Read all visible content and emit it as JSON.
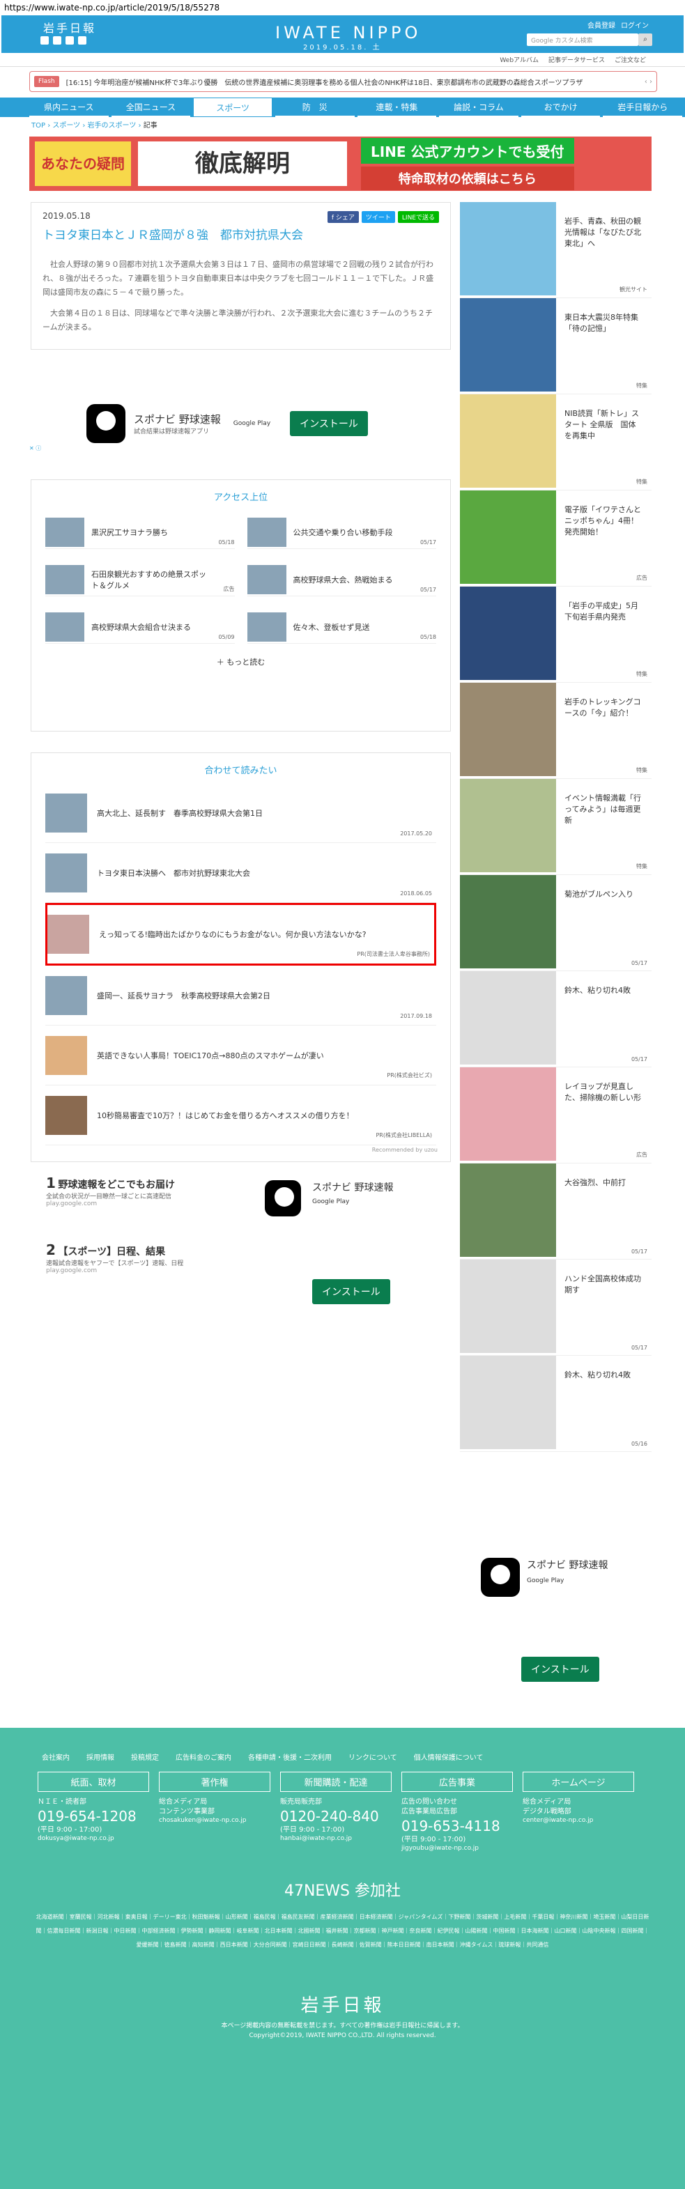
{
  "url": "https://www.iwate-np.co.jp/article/2019/5/18/55278",
  "header": {
    "logo_jp": "岩手日報",
    "logo_en": "IWATE NIPPO",
    "date": "2019.05.18. 土",
    "links": [
      "会員登録",
      "ログイン"
    ],
    "search_placeholder": "Google カスタム検索",
    "subnav": [
      "Webアルバム",
      "記事データサービス",
      "ご注文など"
    ]
  },
  "flash": {
    "label": "Flash",
    "time": "[16:15]",
    "text": "今年明治座が候補NHK杯で3年ぶり優勝　伝統の世界遺産候補に奥羽理事を務める個人社会のNHK杯は18日、東京都調布市の武蔵野の森総合スポーツプラザ",
    "nav": "‹ ›"
  },
  "gnav": [
    "県内ニュース",
    "全国ニュース",
    "スポーツ",
    "防　災",
    "連載・特集",
    "論説・コラム",
    "おでかけ",
    "岩手日報から"
  ],
  "breadcrumb": [
    "TOP",
    "スポーツ",
    "岩手のスポーツ",
    "記事"
  ],
  "banner": {
    "yellow": "あなたの疑問",
    "middle": "徹底解明",
    "line1": "LINE 公式アカウントでも受付",
    "line2": "特命取材の依頼はこちら"
  },
  "article": {
    "date": "2019.05.18",
    "title": "トヨタ東日本とＪＲ盛岡が８強　都市対抗県大会",
    "share": [
      "f シェア",
      "ツイート",
      "LINEで送る"
    ],
    "body": [
      "社会人野球の第９０回都市対抗１次予選県大会第３日は１７日、盛岡市の県営球場で２回戦の残り２試合が行われ、８強が出そろった。７連覇を狙うトヨタ自動車東日本は中央クラブを七回コールド１１－１で下した。ＪＲ盛岡は盛岡市友の森に５－４で競り勝った。",
      "大会第４日の１８日は、同球場などで準々決勝と準決勝が行われ、２次予選東北大会に進む３チームのうち２チームが決まる。"
    ]
  },
  "ad_app": {
    "title": "スポナビ 野球速報",
    "sub": "試合結果は野球速報アプリ",
    "store": "Google Play",
    "install": "インストール"
  },
  "access": {
    "title": "アクセス上位",
    "items": [
      {
        "title": "黒沢尻工サヨナラ勝ち",
        "date": "05/18"
      },
      {
        "title": "公共交通や乗り合い移動手段",
        "date": "05/17"
      },
      {
        "title": "石田泉観光おすすめの絶景スポット＆グルメ",
        "date": "広告"
      },
      {
        "title": "高校野球県大会、熱戦始まる",
        "date": "05/17"
      },
      {
        "title": "高校野球県大会組合せ決まる",
        "date": "05/09"
      },
      {
        "title": "佐々木、登板せず見送",
        "date": "05/18"
      }
    ],
    "more": "もっと読む"
  },
  "related": {
    "title": "合わせて読みたい",
    "items": [
      {
        "title": "高大北上、延長制す　春季高校野球県大会第1日",
        "date": "2017.05.20"
      },
      {
        "title": "トヨタ東日本決勝へ　都市対抗野球東北大会",
        "date": "2018.06.05"
      },
      {
        "title": "えっ知ってる!臨時出たばかりなのにもうお金がない。何か良い方法ないかな?",
        "date": "PR(司法書士法人卑谷事務所)"
      },
      {
        "title": "盛岡一、延長サヨナラ　秋季高校野球県大会第2日",
        "date": "2017.09.18"
      },
      {
        "title": "英語できない人事局！TOEIC170点→880点のスマホゲームが凄い",
        "date": "PR(株式会社ビズ)"
      },
      {
        "title": "10秒簡易審査で10万？！はじめてお金を借りる方へオススメの借り方を！",
        "date": "PR(株式会社LIBELLA)"
      }
    ],
    "recommended": "Recommended by  uzou"
  },
  "gads": [
    {
      "num": "1",
      "title": "野球速報をどこでもお届け",
      "sub": "全試合の状況が一目瞭然一球ごとに高速配信",
      "domain": "play.google.com"
    },
    {
      "num": "2",
      "title": "【スポーツ】日程、結果",
      "sub": "速報試合速報をヤフーで【スポーツ】速報、日程",
      "domain": "play.google.com"
    }
  ],
  "sidebar": [
    {
      "title": "岩手、青森、秋田の観光情報は「なびたび北東北」へ",
      "tag": "観光サイト"
    },
    {
      "title": "東日本大震災8年特集「待の記憶」",
      "tag": "特集"
    },
    {
      "title": "NIB読買「新トレ」スタート 全県版　国体を再集中",
      "tag": "特集"
    },
    {
      "title": "電子版「イワテさんとニッポちゃん」4冊！発売開始！",
      "tag": "広告"
    },
    {
      "title": "「岩手の平成史」5月下旬岩手県内発売",
      "tag": "特集"
    },
    {
      "title": "岩手のトレッキングコースの「今」紹介！",
      "tag": "特集"
    },
    {
      "title": "イベント情報満載「行ってみよう」は毎週更新",
      "tag": "特集"
    },
    {
      "title": "菊池がブルペン入り",
      "tag": "05/17"
    },
    {
      "title": "鈴木、粘り切れ4敗",
      "tag": "05/17"
    },
    {
      "title": "レイヨップが見直した、掃除機の新しい形",
      "tag": "広告"
    },
    {
      "title": "大谷強烈、中前打",
      "tag": "05/17"
    },
    {
      "title": "ハンド全国高校体成功期す",
      "tag": "05/17"
    },
    {
      "title": "鈴木、粘り切れ4敗",
      "tag": "05/16"
    }
  ],
  "footer": {
    "nav": [
      "会社案内",
      "採用情報",
      "投稿規定",
      "広告料金のご案内",
      "各種申請・後援・二次利用",
      "リンクについて",
      "個人情報保護について"
    ],
    "boxes": [
      {
        "head": "紙面、取材",
        "lines": [
          "ＮＩＥ・読者部"
        ],
        "tel": "019-654-1208",
        "hours": "(平日 9:00 - 17:00)",
        "mail": "dokusya@iwate-np.co.jp"
      },
      {
        "head": "著作権",
        "lines": [
          "総合メディア局",
          "コンテンツ事業部"
        ],
        "tel": "",
        "hours": "",
        "mail": "chosakuken@iwate-np.co.jp"
      },
      {
        "head": "新聞購読・配達",
        "lines": [
          "販売局販売部"
        ],
        "tel": "0120-240-840",
        "hours": "(平日 9:00 - 17:00)",
        "mail": "hanbai@iwate-np.co.jp"
      },
      {
        "head": "広告事業",
        "lines": [
          "広告の問い合わせ",
          "広告事業局広告部"
        ],
        "tel": "019-653-4118",
        "hours": "(平日 9:00 - 17:00)",
        "mail": "jigyoubu@iwate-np.co.jp"
      },
      {
        "head": "ホームページ",
        "lines": [
          "総合メディア局",
          "デジタル戦略部"
        ],
        "tel": "",
        "hours": "",
        "mail": "center@iwate-np.co.jp"
      }
    ],
    "title47": "47NEWS 参加社",
    "papers": "北海道新聞｜室蘭民報｜河北新報｜東奥日報｜デーリー東北｜秋田魁新報｜山形新聞｜福島民報｜福島民友新聞｜産業経済新聞｜日本経済新聞｜ジャパンタイムズ｜下野新聞｜茨城新聞｜上毛新聞｜千葉日報｜神奈川新聞｜埼玉新聞｜山梨日日新聞｜信濃毎日新聞｜新潟日報｜中日新聞｜中部経済新聞｜伊勢新聞｜静岡新聞｜岐阜新聞｜北日本新聞｜北國新聞｜福井新聞｜京都新聞｜神戸新聞｜奈良新聞｜紀伊民報｜山陽新聞｜中国新聞｜日本海新聞｜山口新聞｜山陰中央新報｜四国新聞｜愛媛新聞｜徳島新聞｜高知新聞｜西日本新聞｜大分合同新聞｜宮崎日日新聞｜長崎新聞｜佐賀新聞｜熊本日日新聞｜南日本新聞｜沖縄タイムス｜琉球新報｜共同通信",
    "logo": "岩手日報",
    "copy1": "本ページ掲載内容の無断転載を禁じます。すべての著作権は岩手日報社に帰属します。",
    "copy2": "Copyright©2019, IWATE NIPPO CO.,LTD. All rights reserved."
  }
}
